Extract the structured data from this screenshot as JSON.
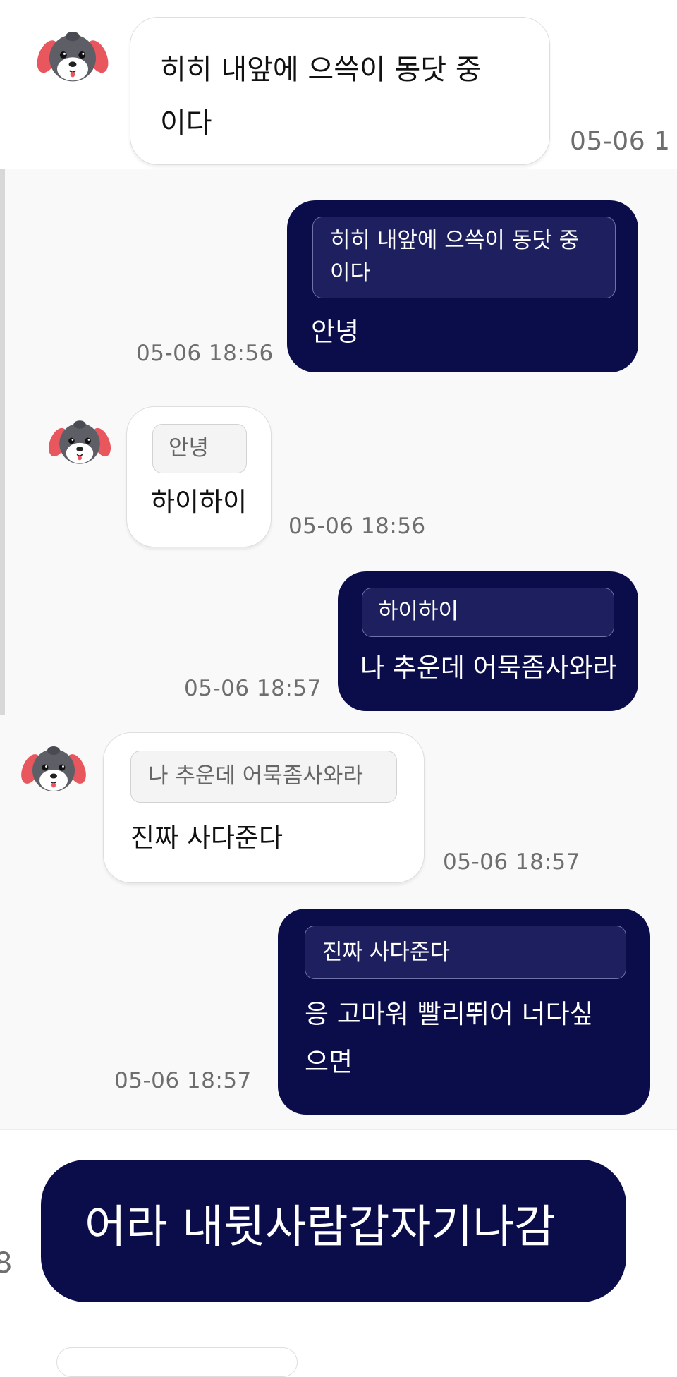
{
  "colors": {
    "outgoing_bubble": "#0b0c4a",
    "incoming_bubble": "#ffffff",
    "timestamp_text": "#6e6e6e"
  },
  "icons": {
    "avatar": "puppy-avatar-icon"
  },
  "messages": [
    {
      "direction": "incoming",
      "quote": "",
      "text": "히히 내앞에 으쓱이 동닷 중\n이다",
      "time": "05-06 1"
    },
    {
      "direction": "outgoing",
      "quote": "히히 내앞에 으쓱이 동닷 중\n이다",
      "text": "안녕",
      "time": "05-06 18:56"
    },
    {
      "direction": "incoming",
      "quote": "안녕",
      "text": "하이하이",
      "time": "05-06 18:56"
    },
    {
      "direction": "outgoing",
      "quote": "하이하이",
      "text": "나 추운데 어묵좀사와라",
      "time": "05-06 18:57"
    },
    {
      "direction": "incoming",
      "quote": "나 추운데 어묵좀사와라",
      "text": "진짜 사다준다",
      "time": "05-06 18:57"
    },
    {
      "direction": "outgoing",
      "quote": "진짜 사다준다",
      "text": "응 고마워 빨리뛰어 너다싶\n으면",
      "time": "05-06 18:57"
    },
    {
      "direction": "outgoing",
      "quote": "",
      "text": "어라 내뒷사람갑자기나감",
      "time": "8"
    }
  ]
}
